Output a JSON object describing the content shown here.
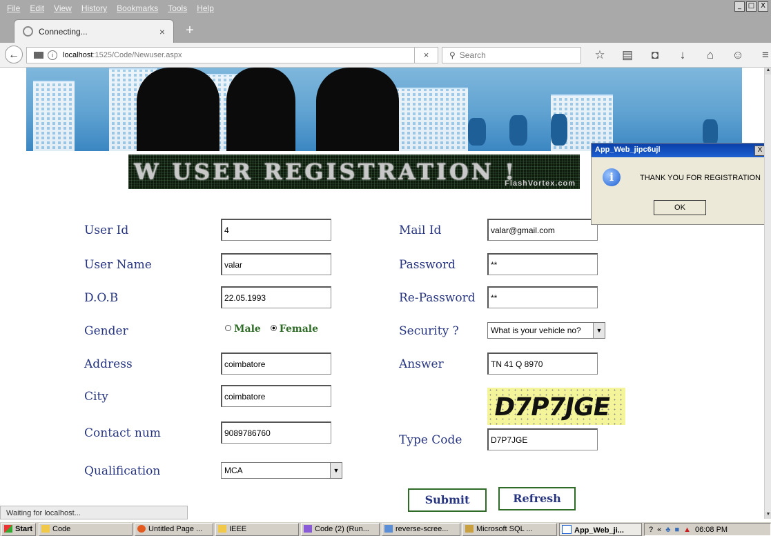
{
  "browser": {
    "menu": [
      "File",
      "Edit",
      "View",
      "History",
      "Bookmarks",
      "Tools",
      "Help"
    ],
    "window_controls": [
      "_",
      "□",
      "X"
    ],
    "tab_title": "Connecting...",
    "new_tab": "+",
    "url_host": "localhost",
    "url_path": ":1525/Code/Newuser.aspx",
    "search_placeholder": "Search",
    "status_text": "Waiting for localhost..."
  },
  "banner": {
    "title": "W USER REGISTRATION !",
    "watermark": "FlashVortex.com"
  },
  "form": {
    "left": [
      {
        "label": "User Id",
        "value": "4"
      },
      {
        "label": "User Name",
        "value": "valar"
      },
      {
        "label": "D.O.B",
        "value": "22.05.1993"
      },
      {
        "label": "Gender"
      },
      {
        "label": "Address",
        "value": "coimbatore"
      },
      {
        "label": "City",
        "value": "coimbatore"
      },
      {
        "label": "Contact num",
        "value": "9089786760"
      },
      {
        "label": "Qualification",
        "value": "MCA"
      }
    ],
    "gender_options": [
      "Male",
      "Female"
    ],
    "gender_selected": "Female",
    "right": [
      {
        "label": "Mail Id",
        "value": "valar@gmail.com"
      },
      {
        "label": "Password",
        "value": "**"
      },
      {
        "label": "Re-Password",
        "value": "**"
      },
      {
        "label": "Security ?",
        "value": "What is your vehicle no?"
      },
      {
        "label": "Answer",
        "value": "TN 41 Q 8970"
      },
      {
        "label": "Type Code",
        "value": "D7P7JGE"
      }
    ],
    "captcha": "D7P7JGE",
    "submit": "Submit",
    "refresh": "Refresh"
  },
  "dialog": {
    "title": "App_Web_jipc6ujl",
    "message": "THANK YOU FOR REGISTRATION",
    "ok": "OK",
    "close": "X"
  },
  "taskbar": {
    "start": "Start",
    "items": [
      "Code",
      "Untitled Page ...",
      "IEEE",
      "Code (2) (Run...",
      "reverse-scree...",
      "Microsoft SQL ...",
      "App_Web_ji..."
    ],
    "clock": "06:08 PM"
  },
  "colors": {
    "label": "#273580",
    "radio_text": "#2e6b26",
    "dialog_title": "#1d5fd1",
    "captcha_bg": "#f4f49a"
  }
}
